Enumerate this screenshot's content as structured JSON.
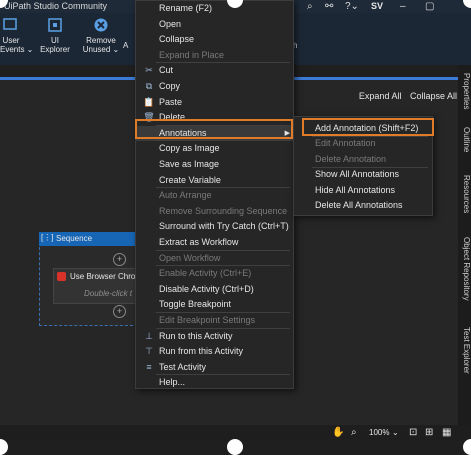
{
  "window": {
    "title": "UiPath Studio Community",
    "user_initials": "SV"
  },
  "ribbon": {
    "buttons": [
      {
        "label": "User\nEvents ⌄"
      },
      {
        "label": "UI\nExplorer"
      },
      {
        "label": "Remove\nUnused ⌄"
      }
    ],
    "partial_right": "h"
  },
  "designer": {
    "expand_all": "Expand All",
    "collapse_all": "Collapse All"
  },
  "sequence": {
    "title": "Sequence",
    "activity": "Use Browser Chron",
    "hint": "Double-click t"
  },
  "context_menu": {
    "items": [
      {
        "label": "Rename (F2)",
        "disabled": false,
        "icon": ""
      },
      {
        "label": "Open",
        "disabled": false,
        "icon": ""
      },
      {
        "label": "Collapse",
        "disabled": false,
        "icon": ""
      },
      {
        "label": "Expand in Place",
        "disabled": true,
        "icon": ""
      },
      {
        "label": "Cut",
        "disabled": false,
        "icon": "cut-icon"
      },
      {
        "label": "Copy",
        "disabled": false,
        "icon": "copy-icon"
      },
      {
        "label": "Paste",
        "disabled": false,
        "icon": "paste-icon"
      },
      {
        "label": "Delete",
        "disabled": false,
        "icon": "delete-icon"
      },
      {
        "label": "Annotations",
        "disabled": false,
        "icon": "",
        "submenu": true
      },
      {
        "label": "Copy as Image",
        "disabled": false,
        "icon": ""
      },
      {
        "label": "Save as Image",
        "disabled": false,
        "icon": ""
      },
      {
        "label": "Create Variable",
        "disabled": false,
        "icon": ""
      },
      {
        "label": "Auto Arrange",
        "disabled": true,
        "icon": ""
      },
      {
        "label": "Remove Surrounding Sequence",
        "disabled": true,
        "icon": ""
      },
      {
        "label": "Surround with Try Catch (Ctrl+T)",
        "disabled": false,
        "icon": ""
      },
      {
        "label": "Extract as Workflow",
        "disabled": false,
        "icon": ""
      },
      {
        "label": "Open Workflow",
        "disabled": true,
        "icon": ""
      },
      {
        "label": "Enable Activity (Ctrl+E)",
        "disabled": true,
        "icon": ""
      },
      {
        "label": "Disable Activity (Ctrl+D)",
        "disabled": false,
        "icon": ""
      },
      {
        "label": "Toggle Breakpoint",
        "disabled": false,
        "icon": ""
      },
      {
        "label": "Edit Breakpoint Settings",
        "disabled": true,
        "icon": ""
      },
      {
        "label": "Run to this Activity",
        "disabled": false,
        "icon": "run-to-icon"
      },
      {
        "label": "Run from this Activity",
        "disabled": false,
        "icon": "run-from-icon"
      },
      {
        "label": "Test Activity",
        "disabled": false,
        "icon": "test-icon"
      },
      {
        "label": "Help...",
        "disabled": false,
        "icon": ""
      }
    ]
  },
  "annotations_submenu": {
    "items": [
      {
        "label": "Add Annotation (Shift+F2)",
        "disabled": false
      },
      {
        "label": "Edit Annotation",
        "disabled": true
      },
      {
        "label": "Delete Annotation",
        "disabled": true
      },
      {
        "label": "Show All Annotations",
        "disabled": false
      },
      {
        "label": "Hide All Annotations",
        "disabled": false
      },
      {
        "label": "Delete All Annotations",
        "disabled": false
      }
    ]
  },
  "sidebar_tabs": [
    "Properties",
    "Outline",
    "Resources",
    "Object Repository",
    "Test Explorer"
  ],
  "status": {
    "zoom": "100%"
  },
  "colors": {
    "highlight": "#e07b2a",
    "accent": "#1766b5"
  }
}
